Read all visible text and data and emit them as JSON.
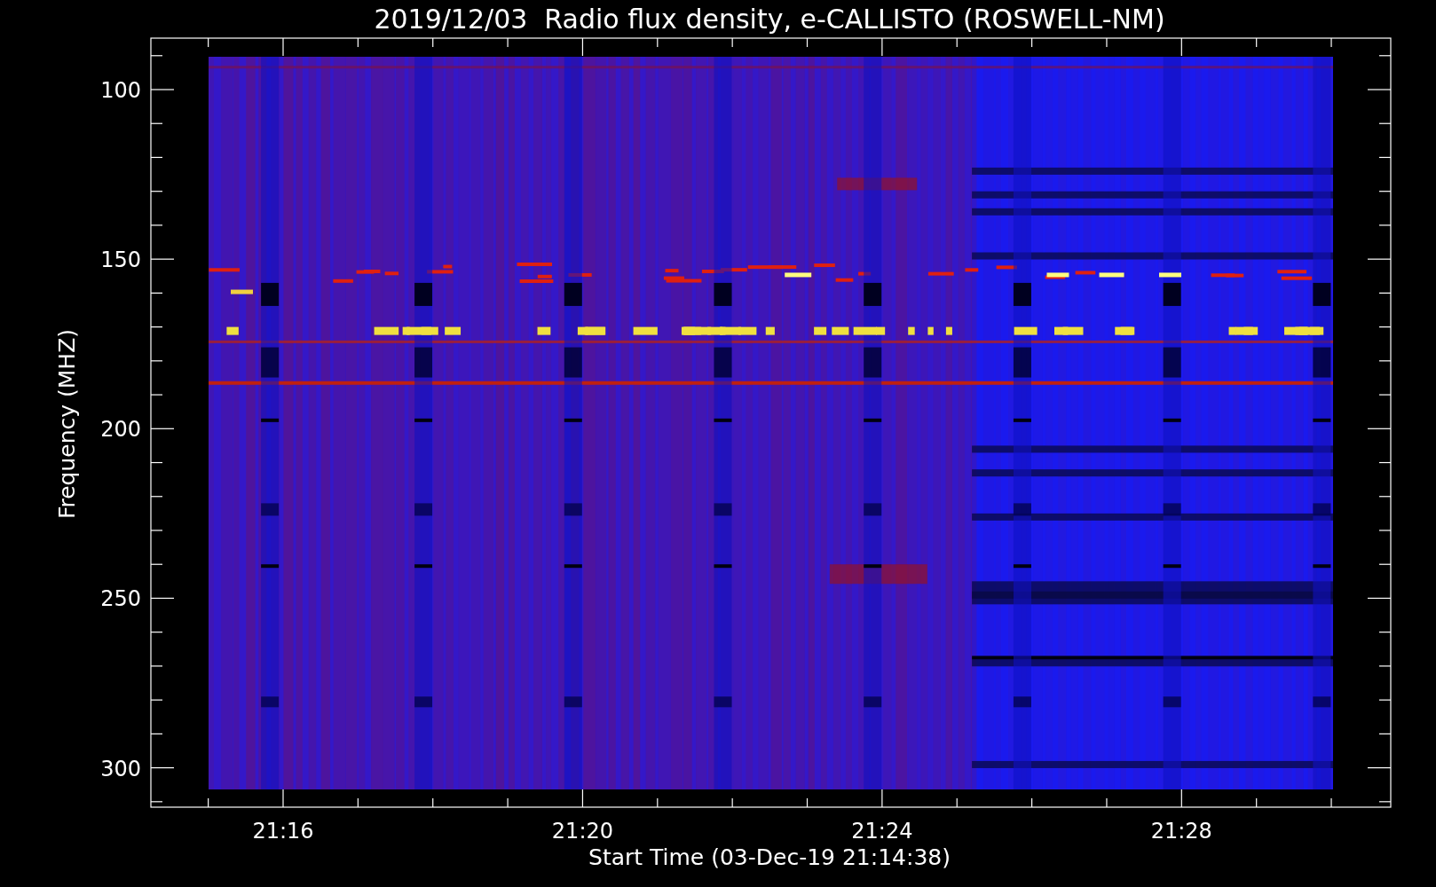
{
  "title": "2019/12/03  Radio flux density, e-CALLISTO (ROSWELL-NM)",
  "y_axis": {
    "label": "Frequency (MHZ)",
    "tick_labels": [
      "100",
      "150",
      "200",
      "250",
      "300"
    ]
  },
  "x_axis": {
    "label": "Start Time (03-Dec-19 21:14:38)",
    "tick_labels": [
      "21:16",
      "21:20",
      "21:24",
      "21:28"
    ]
  }
}
